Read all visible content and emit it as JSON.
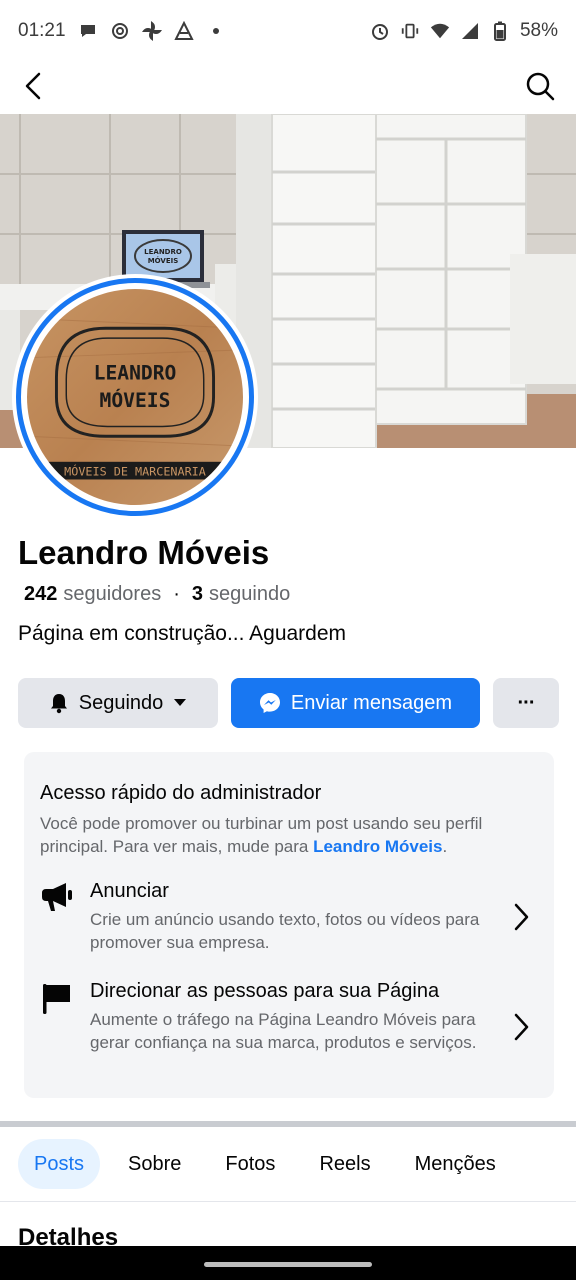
{
  "status_bar": {
    "time": "01:21",
    "battery": "58%",
    "icons_left": [
      "chat-bubble-icon",
      "openai-icon",
      "pinwheel-icon",
      "app-a-icon",
      "dot-icon"
    ],
    "icons_right": [
      "alarm-icon",
      "vibrate-icon",
      "wifi-icon",
      "signal-icon",
      "battery-icon"
    ]
  },
  "top_nav": {
    "back_icon": "chevron-left-icon",
    "search_icon": "search-icon"
  },
  "profile": {
    "logo_line1": "LEANDRO",
    "logo_line2": "MÓVEIS",
    "logo_band": "MÓVEIS DE MARCENARIA",
    "laptop_screen_line1": "LEANDRO",
    "laptop_screen_line2": "MÓVEIS"
  },
  "page": {
    "name": "Leandro Móveis",
    "followers_count": "242",
    "followers_label": "seguidores",
    "separator": "·",
    "following_count": "3",
    "following_label": "seguindo",
    "bio": "Página em construção... Aguardem"
  },
  "actions": {
    "follow_label": "Seguindo",
    "message_label": "Enviar mensagem",
    "more_label": "···"
  },
  "admin": {
    "title": "Acesso rápido do administrador",
    "desc_prefix": "Você pode promover ou turbinar um post usando seu perfil principal. Para ver mais, mude para ",
    "desc_link": "Leandro Móveis",
    "desc_suffix": ".",
    "items": [
      {
        "title": "Anunciar",
        "desc": "Crie um anúncio usando texto, fotos ou vídeos para promover sua empresa.",
        "icon": "megaphone-icon"
      },
      {
        "title": "Direcionar as pessoas para sua Página",
        "desc": "Aumente o tráfego na Página Leandro Móveis para gerar confiança na sua marca, produtos e serviços.",
        "icon": "flag-icon"
      }
    ]
  },
  "tabs": [
    {
      "label": "Posts",
      "active": true
    },
    {
      "label": "Sobre",
      "active": false
    },
    {
      "label": "Fotos",
      "active": false
    },
    {
      "label": "Reels",
      "active": false
    },
    {
      "label": "Menções",
      "active": false
    }
  ],
  "details_heading": "Detalhes",
  "colors": {
    "accent": "#1877f2",
    "button_gray": "#e4e6eb",
    "card_bg": "#f4f5f7",
    "secondary_text": "#65676b"
  }
}
